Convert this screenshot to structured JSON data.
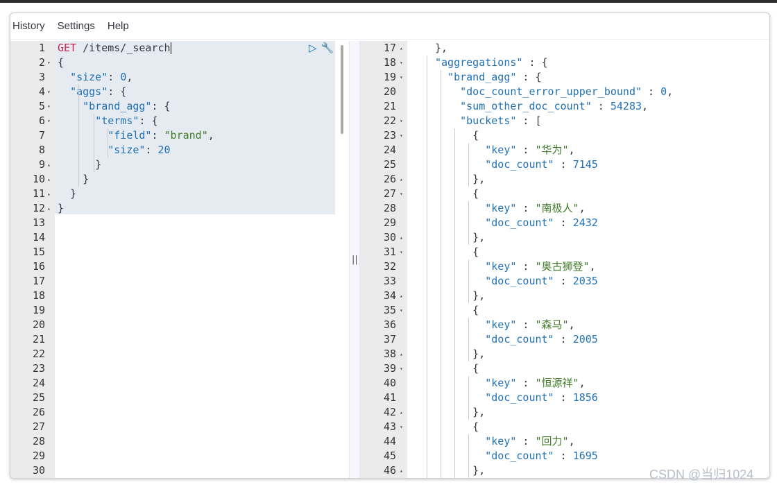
{
  "menu": {
    "history": "History",
    "settings": "Settings",
    "help": "Help"
  },
  "request": {
    "method": "GET",
    "path": "/items/_search",
    "body_lines": [
      "{",
      "  \"size\": 0,",
      "  \"aggs\": {",
      "    \"brand_agg\": {",
      "      \"terms\": {",
      "        \"field\": \"brand\",",
      "        \"size\": 20",
      "      }",
      "    }",
      "  }",
      "}"
    ],
    "line_numbers": [
      "1",
      "2",
      "3",
      "4",
      "5",
      "6",
      "7",
      "8",
      "9",
      "10",
      "11",
      "12",
      "13",
      "14",
      "15",
      "16",
      "17",
      "18",
      "19",
      "20",
      "21",
      "22",
      "23",
      "24",
      "25",
      "26",
      "27",
      "28",
      "29",
      "30"
    ]
  },
  "actions": {
    "run_icon": "play-icon",
    "settings_icon": "wrench-icon",
    "run": "▷",
    "wrench": "🔧"
  },
  "resizer": {
    "glyph": "||"
  },
  "response": {
    "line_numbers": [
      "17",
      "18",
      "19",
      "20",
      "21",
      "22",
      "23",
      "24",
      "25",
      "26",
      "27",
      "28",
      "29",
      "30",
      "31",
      "32",
      "33",
      "34",
      "35",
      "36",
      "37",
      "38",
      "39",
      "40",
      "41",
      "42",
      "43",
      "44",
      "45",
      "46"
    ],
    "fold_marks": {
      "17": "▴",
      "18": "▾",
      "19": "▾",
      "22": "▾",
      "23": "▾",
      "26": "▴",
      "27": "▾",
      "30": "▴",
      "31": "▾",
      "34": "▴",
      "35": "▾",
      "38": "▴",
      "39": "▾",
      "42": "▴",
      "43": "▾",
      "46": "▴"
    },
    "lines": [
      "},",
      "\"aggregations\" : {",
      "  \"brand_agg\" : {",
      "    \"doc_count_error_upper_bound\" : 0,",
      "    \"sum_other_doc_count\" : 54283,",
      "    \"buckets\" : [",
      "      {",
      "        \"key\" : \"华为\",",
      "        \"doc_count\" : 7145",
      "      },",
      "      {",
      "        \"key\" : \"南极人\",",
      "        \"doc_count\" : 2432",
      "      },",
      "      {",
      "        \"key\" : \"奥古狮登\",",
      "        \"doc_count\" : 2035",
      "      },",
      "      {",
      "        \"key\" : \"森马\",",
      "        \"doc_count\" : 2005",
      "      },",
      "      {",
      "        \"key\" : \"恒源祥\",",
      "        \"doc_count\" : 1856",
      "      },",
      "      {",
      "        \"key\" : \"回力\",",
      "        \"doc_count\" : 1695",
      "      },"
    ]
  },
  "request_fold_marks": {
    "2": "▾",
    "4": "▾",
    "5": "▾",
    "6": "▾",
    "9": "▴",
    "10": "▴",
    "11": "▴",
    "12": "▴"
  },
  "watermark": "CSDN @当归1024"
}
